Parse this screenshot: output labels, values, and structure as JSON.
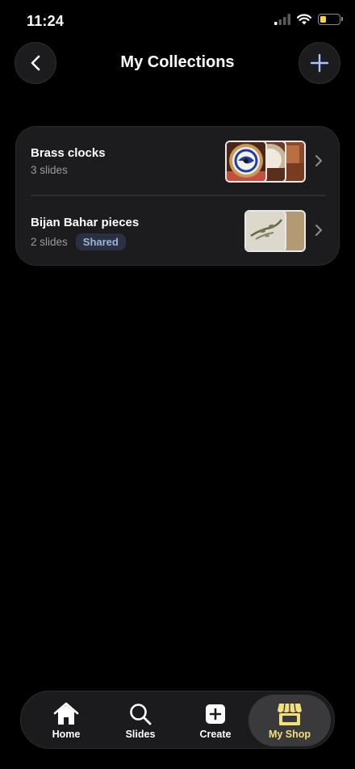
{
  "status_bar": {
    "time": "11:24",
    "battery_color": "#f5d53b"
  },
  "header": {
    "title": "My Collections",
    "back_icon": "chevron-left-icon",
    "add_icon": "plus-icon",
    "accent": "#a8c4ff"
  },
  "collections": [
    {
      "title": "Brass clocks",
      "count": "3 slides",
      "shared": false
    },
    {
      "title": "Bijan Bahar pieces",
      "count": "2 slides",
      "shared": true,
      "shared_label": "Shared"
    }
  ],
  "tab_bar": {
    "tabs": [
      {
        "label": "Home",
        "icon": "home-icon",
        "active": false
      },
      {
        "label": "Slides",
        "icon": "search-icon",
        "active": false
      },
      {
        "label": "Create",
        "icon": "plus-square-icon",
        "active": false
      },
      {
        "label": "My Shop",
        "icon": "shop-icon",
        "active": true
      }
    ],
    "active_color": "#f2e07a"
  }
}
